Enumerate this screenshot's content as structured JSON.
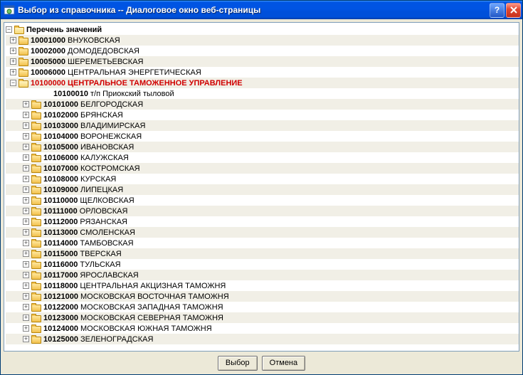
{
  "window": {
    "title": "Выбор из справочника -- Диалоговое окно веб-страницы"
  },
  "buttons": {
    "select": "Выбор",
    "cancel": "Отмена"
  },
  "tree": {
    "root_label": "Перечень значений",
    "top_items": [
      {
        "code": "10001000",
        "name": "ВНУКОВСКАЯ"
      },
      {
        "code": "10002000",
        "name": "ДОМОДЕДОВСКАЯ"
      },
      {
        "code": "10005000",
        "name": "ШЕРЕМЕТЬЕВСКАЯ"
      },
      {
        "code": "10006000",
        "name": "ЦЕНТРАЛЬНАЯ ЭНЕРГЕТИЧЕСКАЯ"
      }
    ],
    "selected": {
      "code": "10100000",
      "name": "ЦЕНТРАЛЬНОЕ ТАМОЖЕННОЕ УПРАВЛЕНИЕ"
    },
    "leaf": {
      "code": "10100010",
      "name": "т/п Приокский тыловой"
    },
    "children": [
      {
        "code": "10101000",
        "name": "БЕЛГОРОДСКАЯ"
      },
      {
        "code": "10102000",
        "name": "БРЯНСКАЯ"
      },
      {
        "code": "10103000",
        "name": "ВЛАДИМИРСКАЯ"
      },
      {
        "code": "10104000",
        "name": "ВОРОНЕЖСКАЯ"
      },
      {
        "code": "10105000",
        "name": "ИВАНОВСКАЯ"
      },
      {
        "code": "10106000",
        "name": "КАЛУЖСКАЯ"
      },
      {
        "code": "10107000",
        "name": "КОСТРОМСКАЯ"
      },
      {
        "code": "10108000",
        "name": "КУРСКАЯ"
      },
      {
        "code": "10109000",
        "name": "ЛИПЕЦКАЯ"
      },
      {
        "code": "10110000",
        "name": "ЩЕЛКОВСКАЯ"
      },
      {
        "code": "10111000",
        "name": "ОРЛОВСКАЯ"
      },
      {
        "code": "10112000",
        "name": "РЯЗАНСКАЯ"
      },
      {
        "code": "10113000",
        "name": "СМОЛЕНСКАЯ"
      },
      {
        "code": "10114000",
        "name": "ТАМБОВСКАЯ"
      },
      {
        "code": "10115000",
        "name": "ТВЕРСКАЯ"
      },
      {
        "code": "10116000",
        "name": "ТУЛЬСКАЯ"
      },
      {
        "code": "10117000",
        "name": "ЯРОСЛАВСКАЯ"
      },
      {
        "code": "10118000",
        "name": "ЦЕНТРАЛЬНАЯ АКЦИЗНАЯ ТАМОЖНЯ"
      },
      {
        "code": "10121000",
        "name": "МОСКОВСКАЯ ВОСТОЧНАЯ ТАМОЖНЯ"
      },
      {
        "code": "10122000",
        "name": "МОСКОВСКАЯ ЗАПАДНАЯ ТАМОЖНЯ"
      },
      {
        "code": "10123000",
        "name": "МОСКОВСКАЯ СЕВЕРНАЯ ТАМОЖНЯ"
      },
      {
        "code": "10124000",
        "name": "МОСКОВСКАЯ ЮЖНАЯ ТАМОЖНЯ"
      },
      {
        "code": "10125000",
        "name": "ЗЕЛЕНОГРАДСКАЯ"
      }
    ]
  }
}
